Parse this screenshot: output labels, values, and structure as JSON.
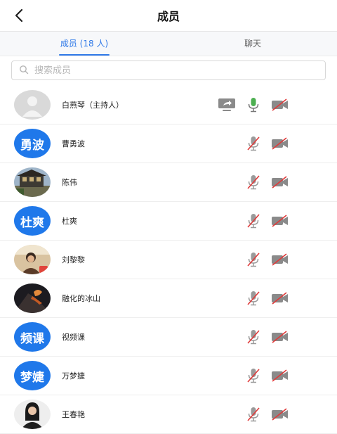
{
  "header": {
    "title": "成员"
  },
  "tabs": [
    {
      "label": "成员 (18 人)",
      "active": true
    },
    {
      "label": "聊天",
      "active": false
    }
  ],
  "search": {
    "placeholder": "搜索成员",
    "value": ""
  },
  "colors": {
    "accent": "#2f79e8",
    "avatar_blue": "#1f78ea",
    "mic_on": "#4caf50",
    "muted_red": "#e03a3a",
    "icon_gray": "#8a8a8a"
  },
  "members": [
    {
      "name": "白燕琴（主持人）",
      "avatar_type": "default-person",
      "share": true,
      "mic": "on",
      "cam": "off"
    },
    {
      "name": "曹勇波",
      "avatar_text": "勇波",
      "avatar_type": "text",
      "mic": "off",
      "cam": "off"
    },
    {
      "name": "陈伟",
      "avatar_type": "photo-building",
      "mic": "off",
      "cam": "off"
    },
    {
      "name": "杜爽",
      "avatar_text": "杜爽",
      "avatar_type": "text",
      "mic": "off",
      "cam": "off"
    },
    {
      "name": "刘黎黎",
      "avatar_type": "photo-person",
      "mic": "off",
      "cam": "off"
    },
    {
      "name": "融化的冰山",
      "avatar_type": "photo-volcano",
      "mic": "off",
      "cam": "off"
    },
    {
      "name": "视频课",
      "avatar_text": "频课",
      "avatar_type": "text",
      "mic": "off",
      "cam": "off"
    },
    {
      "name": "万梦婕",
      "avatar_text": "梦婕",
      "avatar_type": "text",
      "mic": "off",
      "cam": "off"
    },
    {
      "name": "王春艳",
      "avatar_type": "photo-woman",
      "mic": "off",
      "cam": "off"
    }
  ]
}
